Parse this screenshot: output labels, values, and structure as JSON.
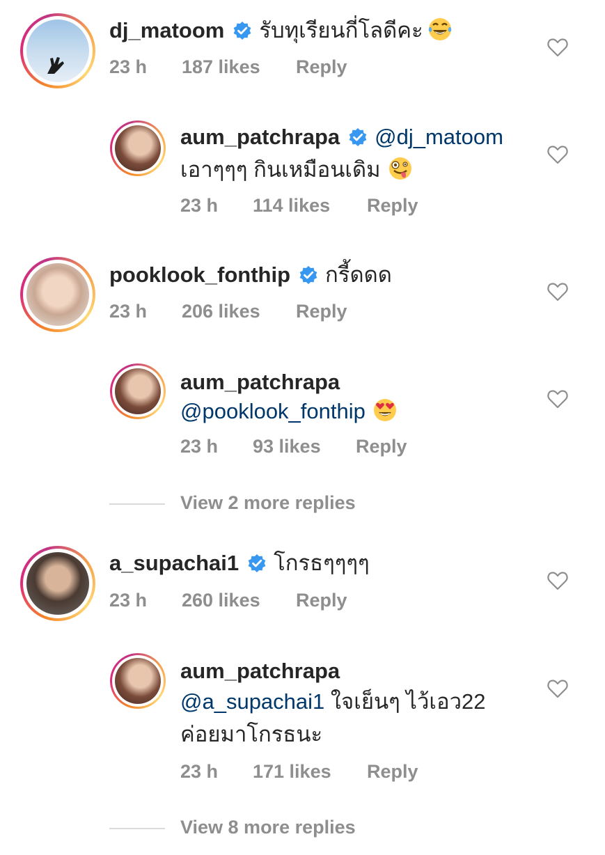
{
  "comments": [
    {
      "username": "dj_matoom",
      "verified": true,
      "text": "รับทุเรียนกี่โลดีคะ",
      "emoji": "tears-of-joy",
      "time": "23 h",
      "likes": "187 likes",
      "reply_label": "Reply",
      "reply": {
        "username": "aum_patchrapa",
        "verified": true,
        "mention": "@dj_matoom",
        "text": "เอาๆๆๆ กินเหมือนเดิม",
        "emoji": "zany-face",
        "time": "23 h",
        "likes": "114 likes",
        "reply_label": "Reply"
      }
    },
    {
      "username": "pooklook_fonthip",
      "verified": true,
      "text": "กรี้ดดด",
      "time": "23 h",
      "likes": "206 likes",
      "reply_label": "Reply",
      "reply": {
        "username": "aum_patchrapa",
        "verified": false,
        "mention": "@pooklook_fonthip",
        "text": "",
        "emoji": "heart-eyes",
        "time": "23 h",
        "likes": "93 likes",
        "reply_label": "Reply"
      },
      "view_more": "View 2 more replies"
    },
    {
      "username": "a_supachai1",
      "verified": true,
      "text": "โกรธๆๆๆๆ",
      "time": "23 h",
      "likes": "260 likes",
      "reply_label": "Reply",
      "reply": {
        "username": "aum_patchrapa",
        "verified": false,
        "mention": "@a_supachai1",
        "text": "ใจเย็นๆ ไว้เอว22",
        "text2": "ค่อยมาโกรธนะ",
        "time": "23 h",
        "likes": "171 likes",
        "reply_label": "Reply"
      },
      "view_more": "View 8 more replies"
    }
  ],
  "colors": {
    "primary_text": "#262626",
    "secondary_text": "#8e8e8e",
    "mention": "#00376b",
    "verified": "#3897f0"
  }
}
